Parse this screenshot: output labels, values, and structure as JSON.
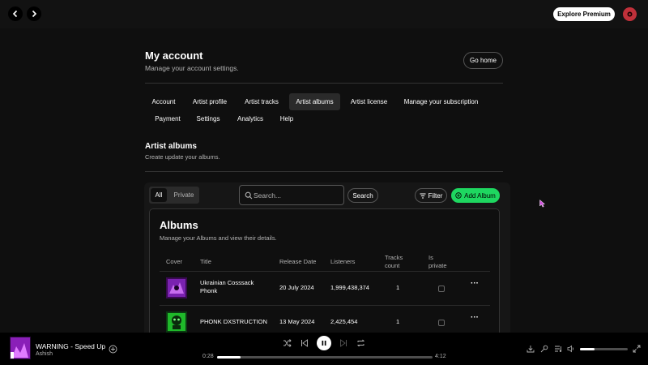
{
  "topbar": {
    "back_icon": "chevron-left-icon",
    "forward_icon": "chevron-right-icon",
    "premium_label": "Explore Premium",
    "avatar_icon": "user-avatar-icon"
  },
  "page": {
    "title": "My account",
    "subtitle": "Manage your account settings.",
    "go_home_label": "Go home"
  },
  "tabs": [
    {
      "label": "Account",
      "active": false
    },
    {
      "label": "Artist profile",
      "active": false
    },
    {
      "label": "Artist tracks",
      "active": false
    },
    {
      "label": "Artist albums",
      "active": true
    },
    {
      "label": "Artist license",
      "active": false
    },
    {
      "label": "Manage your subscription",
      "active": false
    },
    {
      "label": "Payment",
      "active": false
    },
    {
      "label": "Settings",
      "active": false
    },
    {
      "label": "Analytics",
      "active": false
    },
    {
      "label": "Help",
      "active": false
    }
  ],
  "section": {
    "title": "Artist albums",
    "subtitle": "Create update your albums."
  },
  "toolbar": {
    "toggle_all": "All",
    "toggle_private": "Private",
    "search_placeholder": "Search...",
    "search_value": "",
    "search_label": "Search",
    "filter_label": "Filter",
    "add_label": "Add Album"
  },
  "albums": {
    "title": "Albums",
    "subtitle": "Manage your Albums and view their details.",
    "columns": {
      "cover": "Cover",
      "title": "Title",
      "release": "Release Date",
      "listeners": "Listeners",
      "tracks": "Tracks count",
      "private": "Is private"
    },
    "rows": [
      {
        "title": "Ukrainian Cosssack Phonk",
        "release": "20 July 2024",
        "listeners": "1,999,438,374",
        "tracks": "1",
        "is_private": false,
        "more": "···"
      },
      {
        "title": "PHONK DXSTRUCTION",
        "release": "13 May 2024",
        "listeners": "2,425,454",
        "tracks": "1",
        "is_private": false,
        "more": "···"
      }
    ]
  },
  "player": {
    "track_title": "WARNING - Speed Up",
    "artist": "Ashish",
    "elapsed": "0:28",
    "duration": "4:12",
    "progress": 0.11,
    "volume": 0.3
  },
  "colors": {
    "accent": "#1ed760",
    "background": "#000000",
    "surface": "#121212"
  }
}
